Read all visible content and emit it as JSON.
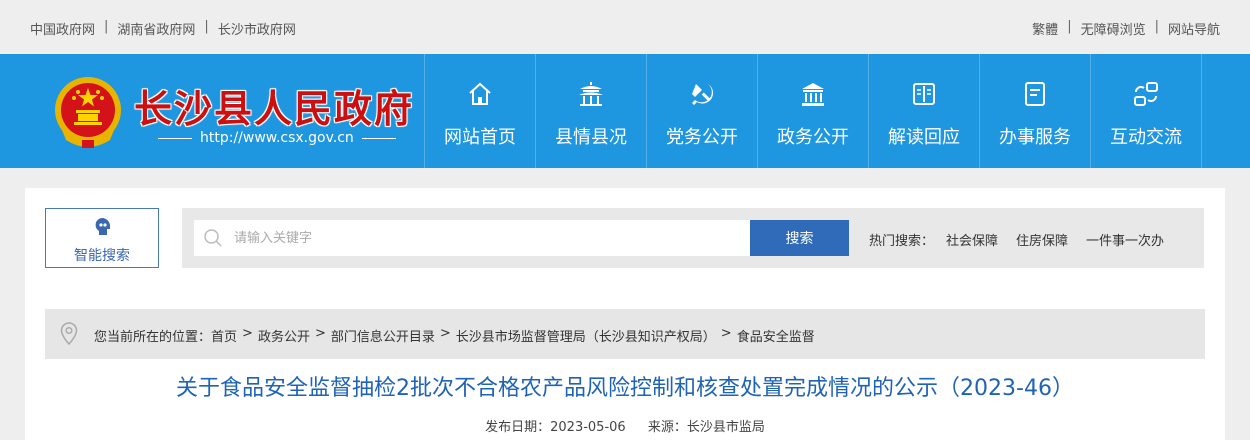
{
  "topbar": {
    "left_links": [
      "中国政府网",
      "湖南省政府网",
      "长沙市政府网"
    ],
    "right_links": [
      "繁體",
      "无障碍浏览",
      "网站导航"
    ],
    "separator": "|"
  },
  "header": {
    "site_title": "长沙县人民政府",
    "site_url": "http://www.csx.gov.cn",
    "nav": [
      {
        "label": "网站首页",
        "icon": "home-icon"
      },
      {
        "label": "县情县况",
        "icon": "pavilion-icon"
      },
      {
        "label": "党务公开",
        "icon": "party-emblem-icon"
      },
      {
        "label": "政务公开",
        "icon": "government-building-icon"
      },
      {
        "label": "解读回应",
        "icon": "book-icon"
      },
      {
        "label": "办事服务",
        "icon": "form-icon"
      },
      {
        "label": "互动交流",
        "icon": "interaction-icon"
      }
    ]
  },
  "search": {
    "smart_label": "智能搜索",
    "placeholder": "请输入关键字",
    "button_label": "搜索",
    "hot_label": "热门搜索：",
    "hot_terms": [
      "社会保障",
      "住房保障",
      "一件事一次办"
    ]
  },
  "breadcrumb": {
    "prefix": "您当前所在的位置：",
    "items": [
      "首页",
      "政务公开",
      "部门信息公开目录",
      "长沙县市场监督管理局（长沙县知识产权局）",
      "食品安全监督"
    ],
    "arrow": ">"
  },
  "article": {
    "title": "关于食品安全监督抽检2批次不合格农产品风险控制和核查处置完成情况的公示（2023-46）",
    "date_label": "发布日期：",
    "date": "2023-05-06",
    "source_label": "来源：",
    "source": "长沙县市监局"
  },
  "colors": {
    "header_blue": "#1e96e0",
    "title_red": "#cc1010",
    "search_button": "#2f6bb8",
    "article_title": "#1f63b6"
  }
}
